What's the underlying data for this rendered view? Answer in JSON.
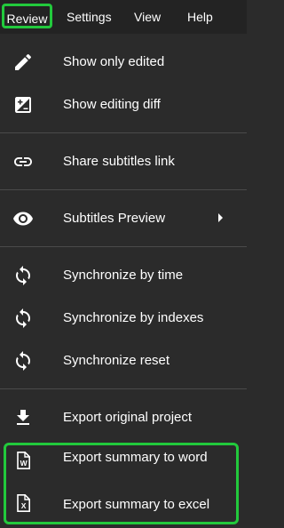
{
  "colors": {
    "background": "#2b2b2b",
    "menubar": "#232323",
    "highlight": "#22c93c",
    "text": "#ffffff"
  },
  "menubar": {
    "review": "Review",
    "settings": "Settings",
    "view": "View",
    "help": "Help"
  },
  "menu": {
    "items": [
      {
        "label": "Show only edited",
        "icon": "pencil-icon"
      },
      {
        "label": "Show editing diff",
        "icon": "diff-icon"
      },
      {
        "label": "Share subtitles link",
        "icon": "link-icon"
      },
      {
        "label": "Subtitles Preview",
        "icon": "eye-icon",
        "submenu": true
      },
      {
        "label": "Synchronize by time",
        "icon": "sync-icon"
      },
      {
        "label": "Synchronize by indexes",
        "icon": "sync-icon"
      },
      {
        "label": "Synchronize reset",
        "icon": "sync-icon"
      },
      {
        "label": "Export original project",
        "icon": "download-icon"
      },
      {
        "label": "Export summary to word",
        "icon": "word-file-icon"
      },
      {
        "label": "Export summary to excel",
        "icon": "excel-file-icon"
      }
    ]
  },
  "icons": {
    "word_letter": "W",
    "excel_letter": "X"
  }
}
